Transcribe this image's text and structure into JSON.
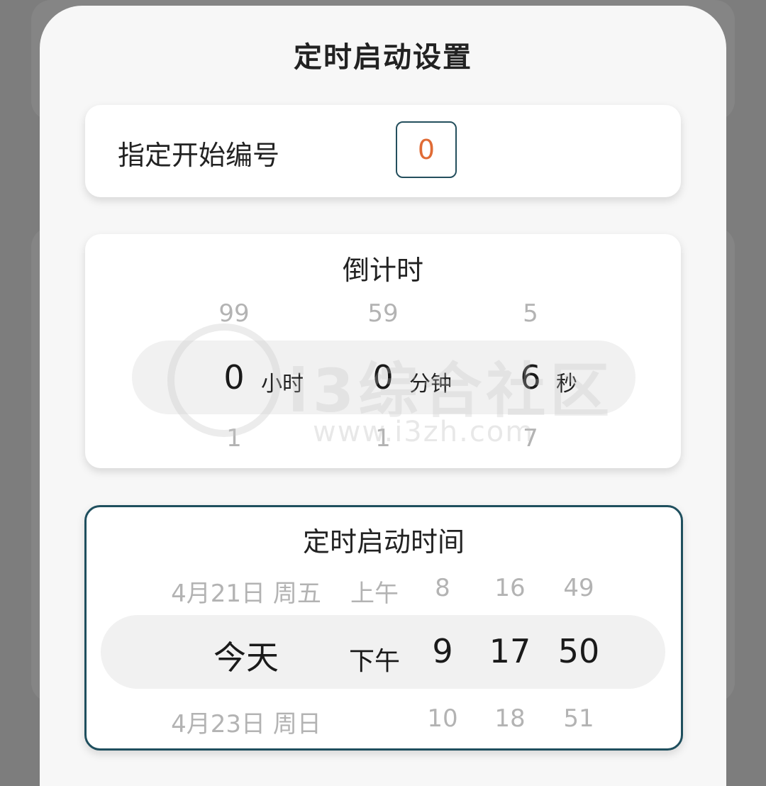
{
  "sheet": {
    "title": "定时启动设置"
  },
  "start_number": {
    "label": "指定开始编号",
    "value": "0"
  },
  "countdown": {
    "title": "倒计时",
    "hours": {
      "prev": "99",
      "value": "0",
      "next": "1",
      "unit": "小时"
    },
    "minutes": {
      "prev": "59",
      "value": "0",
      "next": "1",
      "unit": "分钟"
    },
    "seconds": {
      "prev": "5",
      "value": "6",
      "next": "7",
      "unit": "秒"
    }
  },
  "schedule": {
    "title": "定时启动时间",
    "date": {
      "prev": "4月21日 周五",
      "value": "今天",
      "next": "4月23日 周日"
    },
    "period": {
      "prev": "上午",
      "value": "下午",
      "next": ""
    },
    "hour": {
      "prev": "8",
      "value": "9",
      "next": "10"
    },
    "minute": {
      "prev": "16",
      "value": "17",
      "next": "18"
    },
    "second": {
      "prev": "49",
      "value": "50",
      "next": "51"
    }
  },
  "watermark": {
    "text": "i3综合社区",
    "url": "www.i3zh.com"
  },
  "colors": {
    "accent_border": "#1f4f5e",
    "number_value": "#e06b35"
  }
}
